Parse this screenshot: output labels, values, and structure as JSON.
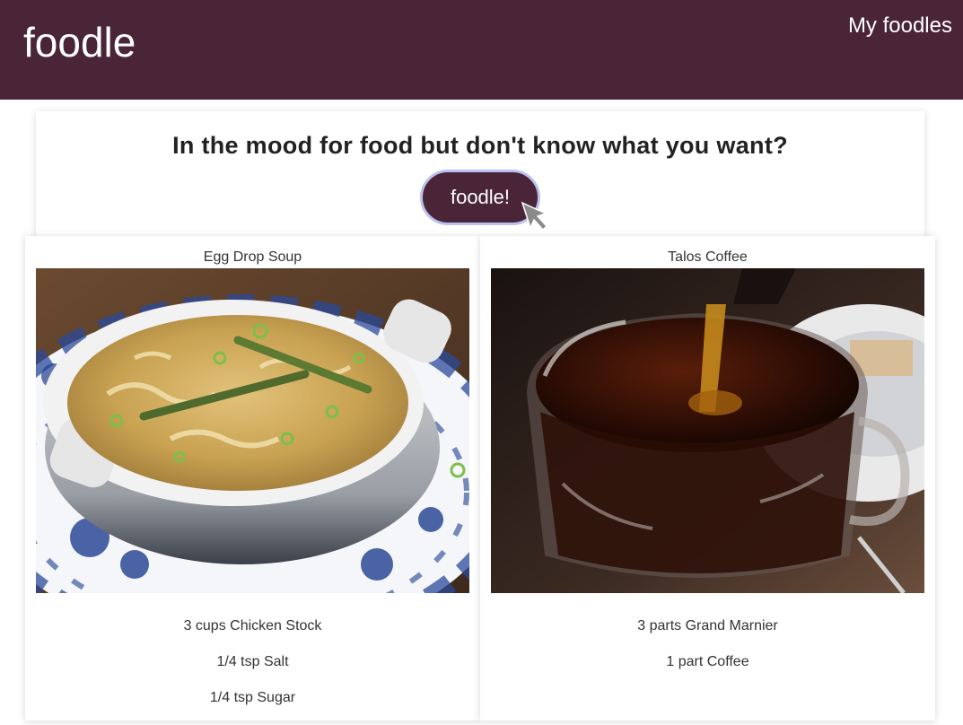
{
  "header": {
    "logo": "foodle",
    "nav_link": "My foodles",
    "background_color": "#4a2437"
  },
  "hero": {
    "title": "In the mood for food but don't know what you want?",
    "button_label": "foodle!"
  },
  "recipes": [
    {
      "title": "Egg Drop Soup",
      "image": "egg-drop-soup-photo",
      "ingredients": [
        "3 cups Chicken Stock",
        "1/4 tsp Salt",
        "1/4 tsp Sugar"
      ]
    },
    {
      "title": "Talos Coffee",
      "image": "talos-coffee-photo",
      "ingredients": [
        "3 parts Grand Marnier",
        "1 part Coffee"
      ]
    }
  ],
  "cursor": "pointer-cursor-icon"
}
